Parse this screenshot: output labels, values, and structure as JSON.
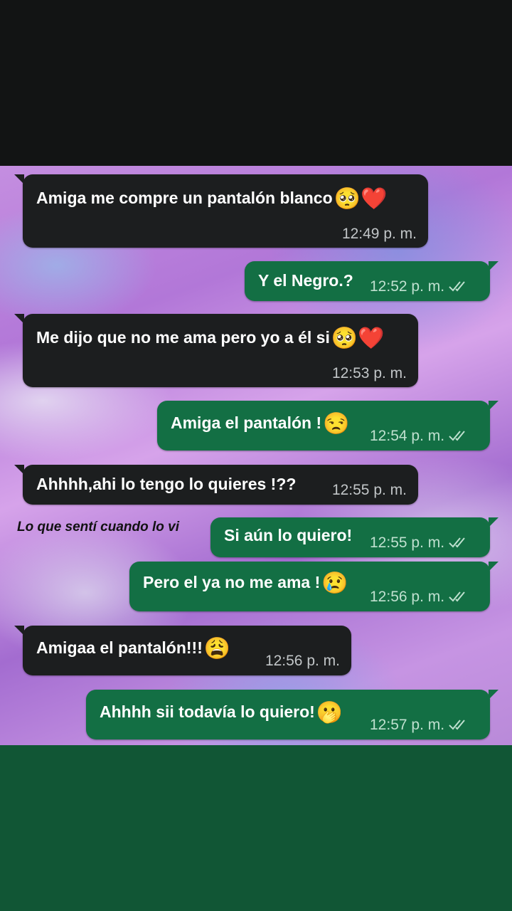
{
  "caption": "Lo que sentí cuando lo vi",
  "icons": {
    "pleading": "🥺",
    "heart": "❤️",
    "unamused": "😒",
    "crying": "😢",
    "weary": "😩",
    "hand_over_mouth": "🫢"
  },
  "colors": {
    "incoming_bubble": "#1c1e1f",
    "outgoing_bubble": "#136f44",
    "bottom_band": "#115635"
  },
  "messages": [
    {
      "direction": "incoming",
      "text": "Amiga me compre un pantalón blanco",
      "emoji": "🥺❤️",
      "time": "12:49 p. m."
    },
    {
      "direction": "outgoing",
      "text": "Y el Negro.?",
      "emoji": "",
      "time": "12:52 p. m.",
      "read": true
    },
    {
      "direction": "incoming",
      "text": "Me dijo que no me ama pero yo a él si",
      "emoji": "🥺❤️",
      "time": "12:53 p. m."
    },
    {
      "direction": "outgoing",
      "text": "Amiga el pantalón !",
      "emoji": "😒",
      "time": "12:54 p. m.",
      "read": true
    },
    {
      "direction": "incoming",
      "text": "Ahhhh,ahi lo tengo lo quieres !??",
      "emoji": "",
      "time": "12:55 p. m."
    },
    {
      "direction": "outgoing",
      "text": "Si aún lo quiero!",
      "emoji": "",
      "time": "12:55 p. m.",
      "read": true
    },
    {
      "direction": "outgoing",
      "text": "Pero el ya no me ama !",
      "emoji": "😢",
      "time": "12:56 p. m.",
      "read": true
    },
    {
      "direction": "incoming",
      "text": "Amigaa el pantalón!!!",
      "emoji": "😩",
      "time": "12:56 p. m."
    },
    {
      "direction": "outgoing",
      "text": "Ahhhh sii todavía lo quiero!",
      "emoji": "🫢",
      "time": "12:57 p. m.",
      "read": true
    }
  ]
}
